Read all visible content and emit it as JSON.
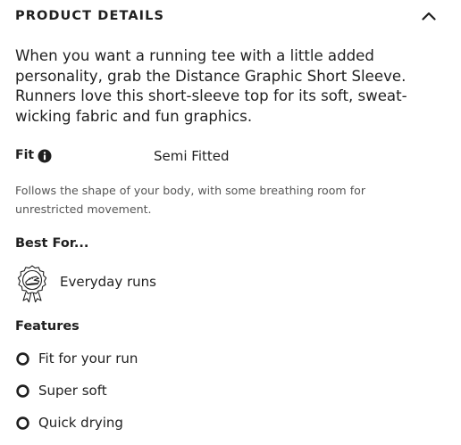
{
  "header": {
    "title": "PRODUCT DETAILS",
    "toggle_icon": "chevron-up-icon"
  },
  "description": "When you want a running tee with a little added personality, grab the Distance Graphic Short Sleeve. Runners love this short-sleeve top for its soft, sweat-wicking fabric and fun graphics.",
  "fit": {
    "label": "Fit",
    "info_icon": "info-icon",
    "value": "Semi Fitted",
    "description": "Follows the shape of your body, with some breathing room for unrestricted movement."
  },
  "best_for": {
    "heading": "Best For...",
    "items": [
      {
        "icon": "award-badge-icon",
        "label": "Everyday runs"
      }
    ]
  },
  "features": {
    "heading": "Features",
    "items": [
      {
        "icon": "circle-icon",
        "label": "Fit for your run"
      },
      {
        "icon": "circle-icon",
        "label": "Super soft"
      },
      {
        "icon": "circle-icon",
        "label": "Quick drying"
      }
    ]
  },
  "colors": {
    "text": "#1f1f1f",
    "muted_text": "#555555",
    "background": "#ffffff"
  }
}
